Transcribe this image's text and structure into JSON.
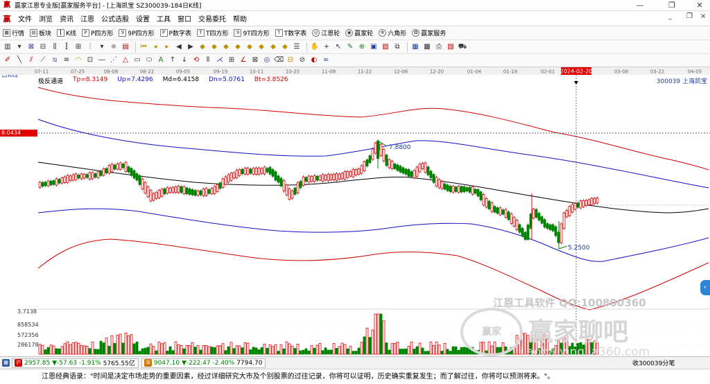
{
  "window": {
    "title": "赢家江恩专业版[赢家服务平台] - [上海凯宝  SZ300039-184日K线]",
    "controls": [
      "—",
      "❐",
      "✕"
    ]
  },
  "menu": {
    "items": [
      "文件",
      "浏览",
      "资讯",
      "江恩",
      "公式选股",
      "设置",
      "工具",
      "窗口",
      "交易委托",
      "帮助"
    ],
    "right_controls": [
      "_",
      "❐",
      "×"
    ]
  },
  "toolbar1": {
    "items": [
      {
        "label": "行情",
        "icon": "grid-icon"
      },
      {
        "label": "板块",
        "icon": "block-icon"
      },
      {
        "label": "K线",
        "icon": "kline-icon"
      },
      {
        "label": "P四方形",
        "icon": "square-icon"
      },
      {
        "label": "9P四方形",
        "icon": "square-icon"
      },
      {
        "label": "P数字表",
        "icon": "table-icon"
      },
      {
        "label": "T四方形",
        "icon": "square-icon"
      },
      {
        "label": "9T四方形",
        "icon": "square-icon"
      },
      {
        "label": "T数字表",
        "icon": "table-icon"
      },
      {
        "label": "江恩轮",
        "icon": "wheel-icon"
      },
      {
        "label": "赢家轮",
        "icon": "wheel-icon"
      },
      {
        "label": "六角形",
        "icon": "hexagon-icon"
      },
      {
        "label": "赢家服务",
        "icon": "service-icon"
      }
    ]
  },
  "chart_header": {
    "period": "日K线",
    "indicator_name": "极反通道",
    "tp": "Tp=8.3149",
    "up": "Up=7.4296",
    "md": "Md=6.4158",
    "dn": "Dn=5.0761",
    "bt": "Bt=3.8526",
    "stock": "300039  上海凯宝",
    "cursor_price": "8.0434",
    "cursor_date": "2024-02-20",
    "volume_max_label": "3.7138",
    "volume_labels": [
      "858534",
      "572356",
      "286178"
    ]
  },
  "chart_data": {
    "type": "candlestick",
    "date_ticks": [
      "07-11",
      "07-25",
      "08-08",
      "08-22",
      "09-05",
      "09-19",
      "10-11",
      "10-25",
      "11-08",
      "11-22",
      "12-06",
      "12-20",
      "01-04",
      "01-18",
      "02-01",
      "2024-02-20",
      "03-08",
      "03-22",
      "04-05"
    ],
    "annotations": [
      "7.8800",
      "5.2500"
    ],
    "series": [
      {
        "name": "Tp",
        "color": "#d00000"
      },
      {
        "name": "Up",
        "color": "#1010c0"
      },
      {
        "name": "Md",
        "color": "#000000"
      },
      {
        "name": "Dn",
        "color": "#1010c0"
      },
      {
        "name": "Bt",
        "color": "#d00000"
      }
    ],
    "up_color": "#e00000",
    "down_color": "#008000"
  },
  "watermark": {
    "line1": "江恩工具软件  QQ:100800360",
    "logo": "赢家",
    "line2": "赢家聊吧",
    "line3": "jiaoba.yingjia360.com"
  },
  "status": {
    "index1_value": "2957.85",
    "index1_change": "▼-57.63",
    "index1_pct": "-1.91%",
    "index1_amount": "5765.55亿",
    "index2_value": "9047.10",
    "index2_change": "▼-222.47",
    "index2_pct": "-2.40%",
    "index2_amount": "7794.70",
    "right": "收300039分笔"
  },
  "quote": "江恩经典语录：\"时间是决定市场走势的重要因素，经过详细研究大市及个别股票的过往记录，你将可以证明，历史确实重复发生；而了解过往，你将可以预测将来。\"。"
}
